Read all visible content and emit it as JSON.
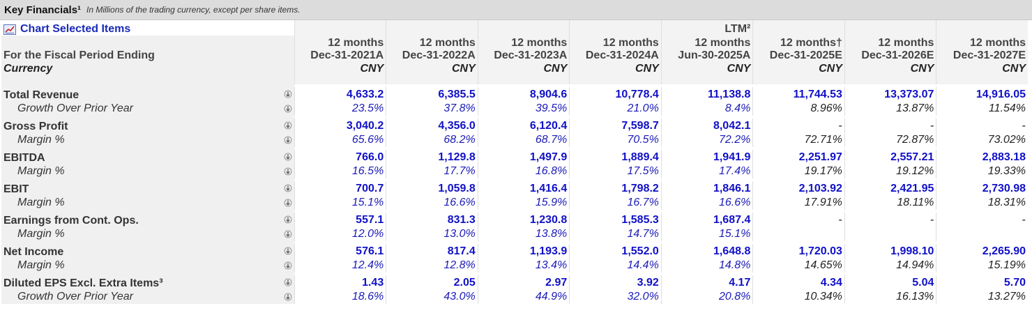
{
  "title": "Key Financials¹",
  "subtitle": "In Millions of the trading currency, except per share items.",
  "chart_selected_label": "Chart Selected Items",
  "period_label": "For the Fiscal Period Ending",
  "currency_label": "Currency",
  "columns": [
    {
      "top": "",
      "mid": "12 months",
      "date": "Dec-31-2021A",
      "cur": "CNY"
    },
    {
      "top": "",
      "mid": "12 months",
      "date": "Dec-31-2022A",
      "cur": "CNY"
    },
    {
      "top": "",
      "mid": "12 months",
      "date": "Dec-31-2023A",
      "cur": "CNY"
    },
    {
      "top": "",
      "mid": "12 months",
      "date": "Dec-31-2024A",
      "cur": "CNY"
    },
    {
      "top": "LTM²",
      "mid": "12 months",
      "date": "Jun-30-2025A",
      "cur": "CNY"
    },
    {
      "top": "",
      "mid": "12 months†",
      "date": "Dec-31-2025E",
      "cur": "CNY"
    },
    {
      "top": "",
      "mid": "12 months",
      "date": "Dec-31-2026E",
      "cur": "CNY"
    },
    {
      "top": "",
      "mid": "12 months",
      "date": "Dec-31-2027E",
      "cur": "CNY"
    }
  ],
  "metrics": [
    {
      "name": "Total Revenue",
      "values": [
        "4,633.2",
        "6,385.5",
        "8,904.6",
        "10,778.4",
        "11,138.8",
        "11,744.53",
        "13,373.07",
        "14,916.05"
      ],
      "sub_name": "Growth Over Prior Year",
      "sub_values": [
        "23.5%",
        "37.8%",
        "39.5%",
        "21.0%",
        "8.4%",
        "8.96%",
        "13.87%",
        "11.54%"
      ]
    },
    {
      "name": "Gross Profit",
      "values": [
        "3,040.2",
        "4,356.0",
        "6,120.4",
        "7,598.7",
        "8,042.1",
        "-",
        "-",
        "-"
      ],
      "sub_name": "Margin %",
      "sub_values": [
        "65.6%",
        "68.2%",
        "68.7%",
        "70.5%",
        "72.2%",
        "72.71%",
        "72.87%",
        "73.02%"
      ]
    },
    {
      "name": "EBITDA",
      "values": [
        "766.0",
        "1,129.8",
        "1,497.9",
        "1,889.4",
        "1,941.9",
        "2,251.97",
        "2,557.21",
        "2,883.18"
      ],
      "sub_name": "Margin %",
      "sub_values": [
        "16.5%",
        "17.7%",
        "16.8%",
        "17.5%",
        "17.4%",
        "19.17%",
        "19.12%",
        "19.33%"
      ]
    },
    {
      "name": "EBIT",
      "values": [
        "700.7",
        "1,059.8",
        "1,416.4",
        "1,798.2",
        "1,846.1",
        "2,103.92",
        "2,421.95",
        "2,730.98"
      ],
      "sub_name": "Margin %",
      "sub_values": [
        "15.1%",
        "16.6%",
        "15.9%",
        "16.7%",
        "16.6%",
        "17.91%",
        "18.11%",
        "18.31%"
      ]
    },
    {
      "name": "Earnings from Cont. Ops.",
      "values": [
        "557.1",
        "831.3",
        "1,230.8",
        "1,585.3",
        "1,687.4",
        "-",
        "-",
        "-"
      ],
      "sub_name": "Margin %",
      "sub_values": [
        "12.0%",
        "13.0%",
        "13.8%",
        "14.7%",
        "15.1%",
        "",
        "",
        ""
      ]
    },
    {
      "name": "Net Income",
      "values": [
        "576.1",
        "817.4",
        "1,193.9",
        "1,552.0",
        "1,648.8",
        "1,720.03",
        "1,998.10",
        "2,265.90"
      ],
      "sub_name": "Margin %",
      "sub_values": [
        "12.4%",
        "12.8%",
        "13.4%",
        "14.4%",
        "14.8%",
        "14.65%",
        "14.94%",
        "15.19%"
      ]
    },
    {
      "name": "Diluted EPS Excl. Extra Items³",
      "values": [
        "1.43",
        "2.05",
        "2.97",
        "3.92",
        "4.17",
        "4.34",
        "5.04",
        "5.70"
      ],
      "sub_name": "Growth Over Prior Year",
      "sub_values": [
        "18.6%",
        "43.0%",
        "44.9%",
        "32.0%",
        "20.8%",
        "10.34%",
        "16.13%",
        "13.27%"
      ]
    }
  ],
  "colors": {
    "value_blue": "#1010c8",
    "header_bg": "#dcdcdc",
    "label_bg": "#f0f0f0",
    "link_blue": "#1a2ab8"
  },
  "icons": {
    "chart": "chart-icon",
    "row_action": "sort-icon"
  }
}
